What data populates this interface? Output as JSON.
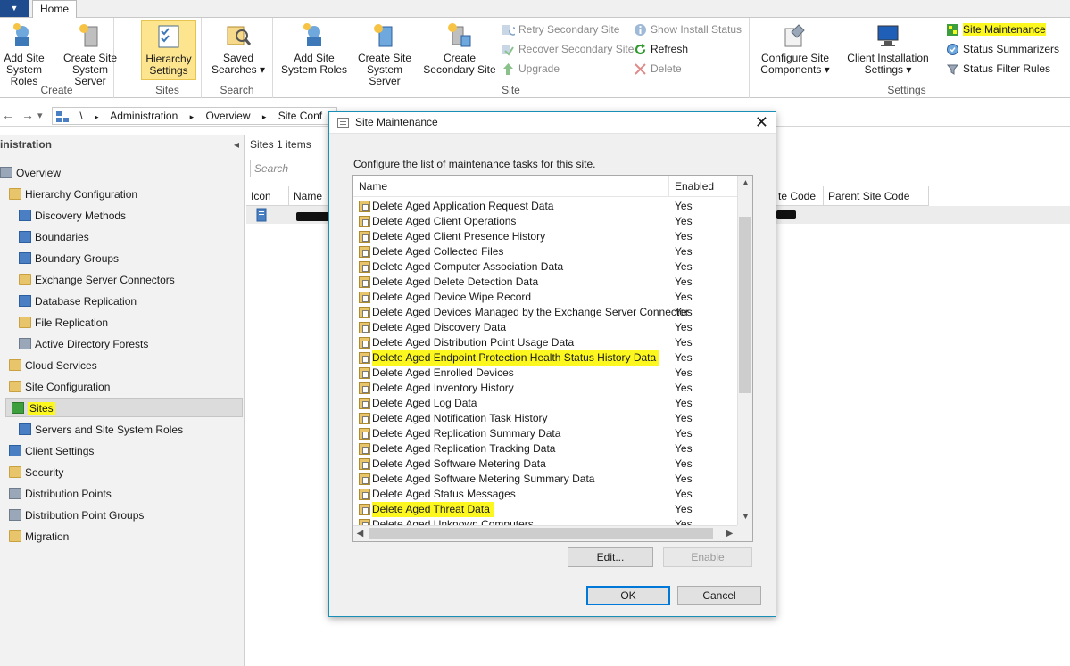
{
  "ribbon": {
    "app_button": "▼",
    "home_tab": "Home",
    "groups": {
      "create": {
        "label": "Create",
        "add_site_system_roles": "Add Site System Roles",
        "create_site_system_server": "Create Site System Server"
      },
      "sites": {
        "label": "Sites",
        "hierarchy_settings": "Hierarchy Settings"
      },
      "search": {
        "label": "Search",
        "saved_searches": "Saved Searches ▾"
      },
      "site": {
        "label": "Site",
        "add_site_system_roles": "Add Site System Roles",
        "create_site_system_server": "Create Site System Server",
        "create_secondary_site": "Create Secondary Site",
        "retry_secondary_site": "Retry Secondary Site",
        "recover_secondary_site": "Recover Secondary Site",
        "upgrade": "Upgrade",
        "show_install_status": "Show Install Status",
        "refresh": "Refresh",
        "delete": "Delete"
      },
      "settings": {
        "label": "Settings",
        "configure_site_components": "Configure Site Components ▾",
        "client_installation_settings": "Client Installation Settings ▾",
        "site_maintenance": "Site Maintenance",
        "status_summarizers": "Status Summarizers",
        "status_filter_rules": "Status Filter Rules"
      }
    }
  },
  "address_bar": {
    "back": "←",
    "forward": "→",
    "dropdown": "▾",
    "crumbs": [
      "\\",
      "▸",
      "Administration",
      "▸",
      "Overview",
      "▸",
      "Site Conf"
    ]
  },
  "nav": {
    "header": "inistration",
    "collapse": "◂",
    "items": [
      {
        "label": "Overview"
      },
      {
        "label": "Hierarchy Configuration"
      },
      {
        "label": "Discovery Methods"
      },
      {
        "label": "Boundaries"
      },
      {
        "label": "Boundary Groups"
      },
      {
        "label": "Exchange Server Connectors"
      },
      {
        "label": "Database Replication"
      },
      {
        "label": "File Replication"
      },
      {
        "label": "Active Directory Forests"
      },
      {
        "label": "Cloud Services"
      },
      {
        "label": "Site Configuration"
      },
      {
        "label": "Sites"
      },
      {
        "label": "Servers and Site System Roles"
      },
      {
        "label": "Client Settings"
      },
      {
        "label": "Security"
      },
      {
        "label": "Distribution Points"
      },
      {
        "label": "Distribution Point Groups"
      },
      {
        "label": "Migration"
      }
    ]
  },
  "content": {
    "title": "Sites 1 items",
    "search_placeholder": "Search",
    "columns": {
      "icon": "Icon",
      "name": "Name",
      "site_code": "te Code",
      "parent_site_code": "Parent Site Code"
    }
  },
  "dialog": {
    "title": "Site Maintenance",
    "close": "✕",
    "description": "Configure the list of maintenance tasks for this site.",
    "columns": {
      "name": "Name",
      "enabled": "Enabled"
    },
    "tasks": [
      {
        "name": "Delete Aged Application Request Data",
        "enabled": "Yes"
      },
      {
        "name": "Delete Aged Client Operations",
        "enabled": "Yes"
      },
      {
        "name": "Delete Aged Client Presence History",
        "enabled": "Yes"
      },
      {
        "name": "Delete Aged Collected Files",
        "enabled": "Yes"
      },
      {
        "name": "Delete Aged Computer Association Data",
        "enabled": "Yes"
      },
      {
        "name": "Delete Aged Delete Detection Data",
        "enabled": "Yes"
      },
      {
        "name": "Delete Aged Device Wipe Record",
        "enabled": "Yes"
      },
      {
        "name": "Delete Aged Devices Managed by the Exchange Server Connector",
        "enabled": "Yes"
      },
      {
        "name": "Delete Aged Discovery Data",
        "enabled": "Yes"
      },
      {
        "name": "Delete Aged Distribution Point Usage Data",
        "enabled": "Yes"
      },
      {
        "name": "Delete Aged Endpoint Protection Health Status History Data",
        "enabled": "Yes"
      },
      {
        "name": "Delete Aged Enrolled Devices",
        "enabled": "Yes"
      },
      {
        "name": "Delete Aged Inventory History",
        "enabled": "Yes"
      },
      {
        "name": "Delete Aged Log Data",
        "enabled": "Yes"
      },
      {
        "name": "Delete Aged Notification Task History",
        "enabled": "Yes"
      },
      {
        "name": "Delete Aged Replication Summary Data",
        "enabled": "Yes"
      },
      {
        "name": "Delete Aged Replication Tracking Data",
        "enabled": "Yes"
      },
      {
        "name": "Delete Aged Software Metering Data",
        "enabled": "Yes"
      },
      {
        "name": "Delete Aged Software Metering Summary Data",
        "enabled": "Yes"
      },
      {
        "name": "Delete Aged Status Messages",
        "enabled": "Yes"
      },
      {
        "name": "Delete Aged Threat Data",
        "enabled": "Yes"
      },
      {
        "name": "Delete Aged Unknown Computers",
        "enabled": "Yes"
      }
    ],
    "buttons": {
      "edit": "Edit...",
      "enable": "Enable",
      "ok": "OK",
      "cancel": "Cancel"
    },
    "scroll": {
      "up": "▲",
      "down": "▼",
      "left": "◀",
      "right": "▶"
    }
  },
  "colors": {
    "highlight": "#fbf71f",
    "dialog_border": "#1a8fb5",
    "selected_ribbon": "#fde58f"
  }
}
